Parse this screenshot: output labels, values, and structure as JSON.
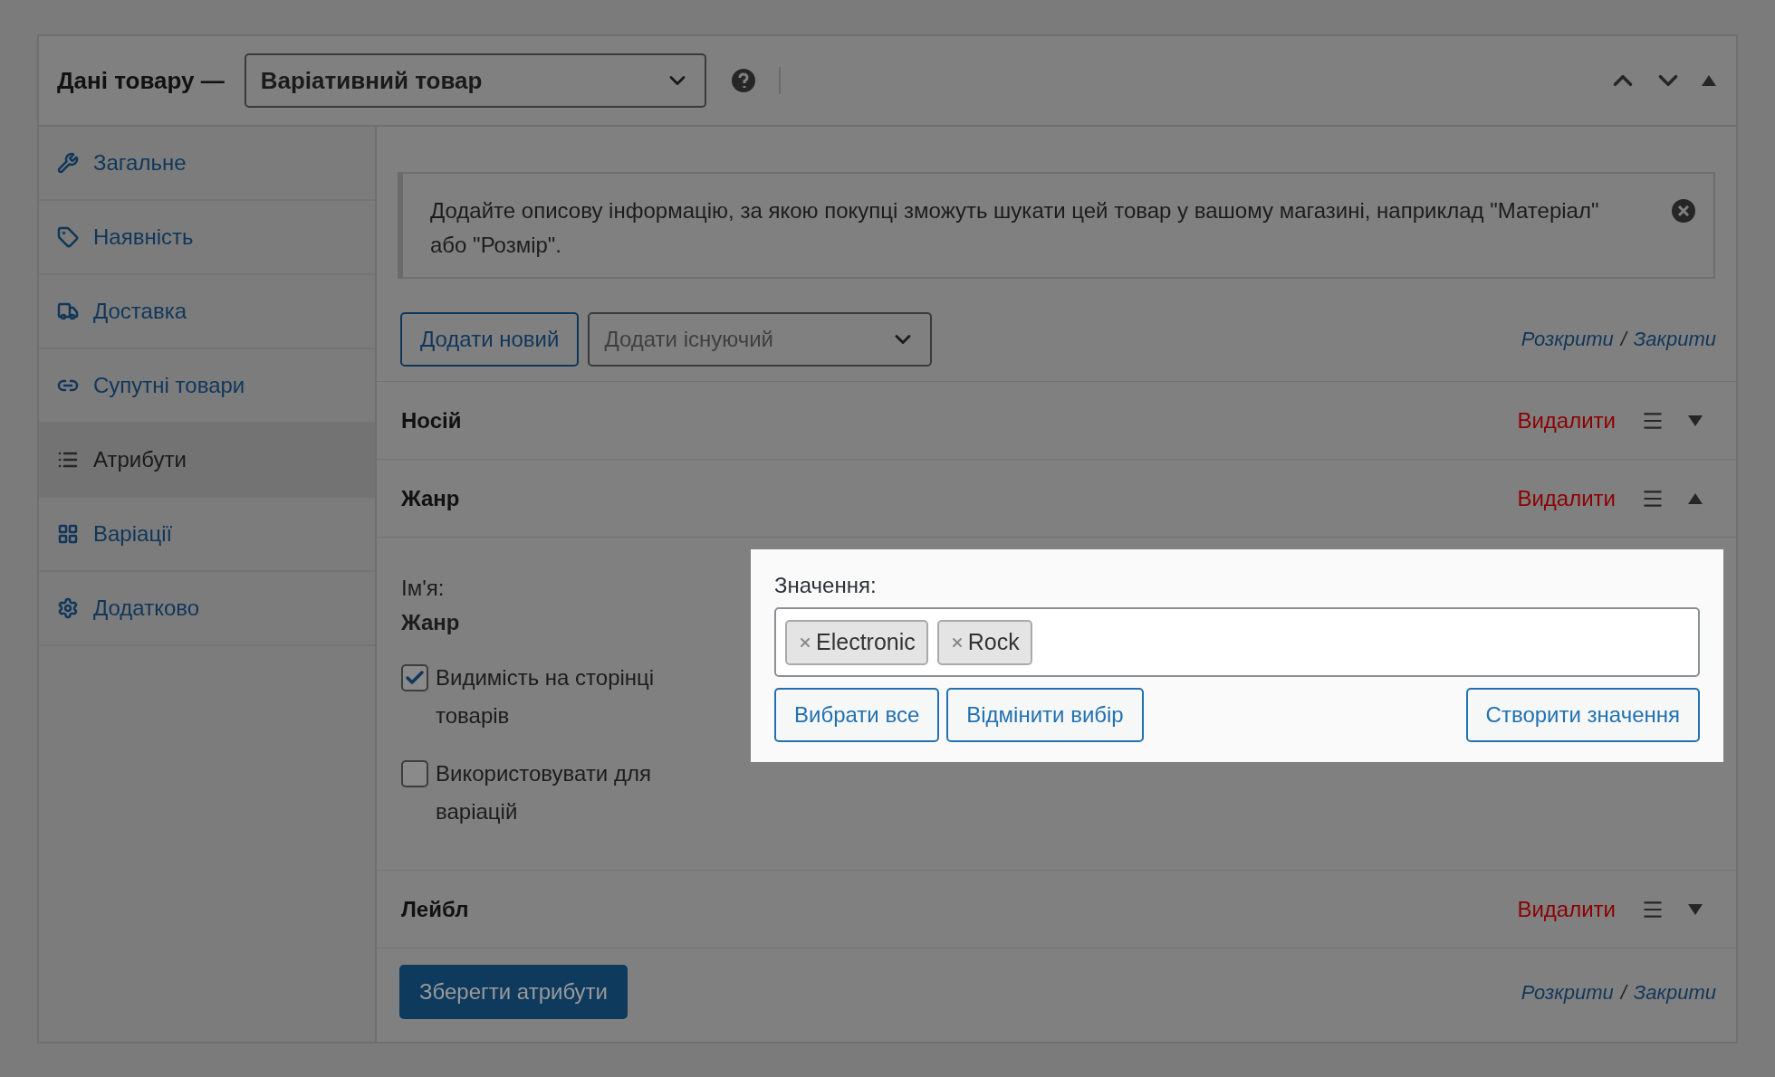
{
  "header": {
    "title": "Дані товару —",
    "product_type": "Варіативний товар"
  },
  "sidebar": {
    "items": [
      {
        "label": "Загальне",
        "kind": "wrench",
        "selected": false
      },
      {
        "label": "Наявність",
        "kind": "tag",
        "selected": false
      },
      {
        "label": "Доставка",
        "kind": "truck",
        "selected": false
      },
      {
        "label": "Супутні товари",
        "kind": "link",
        "selected": false
      },
      {
        "label": "Атрибути",
        "kind": "list",
        "selected": true
      },
      {
        "label": "Варіації",
        "kind": "grid",
        "selected": false
      },
      {
        "label": "Додатково",
        "kind": "gear",
        "selected": false
      }
    ]
  },
  "notice": "Додайте описову інформацію, за якою покупці зможуть шукати цей товар у вашому магазині, наприклад \"Матеріал\" або \"Розмір\".",
  "toolbar": {
    "add_new": "Додати новий",
    "add_existing_placeholder": "Додати існуючий",
    "expand": "Розкрити",
    "separator": "/",
    "collapse": "Закрити"
  },
  "attributes": [
    {
      "name": "Носій",
      "delete": "Видалити",
      "expanded": false
    },
    {
      "name": "Жанр",
      "delete": "Видалити",
      "expanded": true,
      "name_label": "Ім'я:",
      "name_value": "Жанр",
      "checkboxes": [
        {
          "label": "Видимість на сторінці товарів",
          "checked": true
        },
        {
          "label": "Використовувати для варіацій",
          "checked": false
        }
      ],
      "values_label": "Значення:",
      "tags": [
        "Electronic",
        "Rock"
      ],
      "buttons": {
        "select_all": "Вибрати все",
        "deselect": "Відмінити вибір",
        "create": "Створити значення"
      }
    },
    {
      "name": "Лейбл",
      "delete": "Видалити",
      "expanded": false
    }
  ],
  "footer": {
    "save": "Зберегти атрибути",
    "expand": "Розкрити",
    "separator": "/",
    "collapse": "Закрити"
  }
}
